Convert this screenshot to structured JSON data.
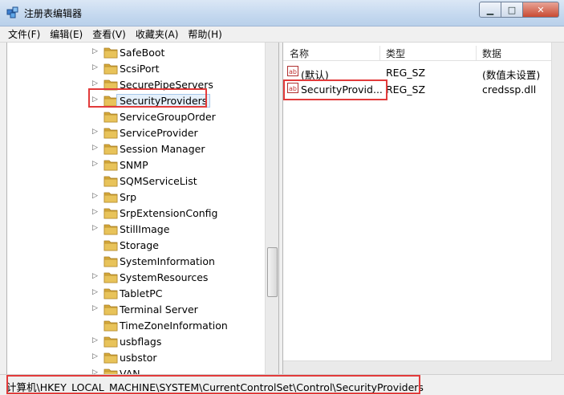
{
  "window": {
    "title": "注册表编辑器",
    "minimize": "▁",
    "maximize": "□",
    "close": "✕"
  },
  "menu": [
    "文件(F)",
    "编辑(E)",
    "查看(V)",
    "收藏夹(A)",
    "帮助(H)"
  ],
  "tree": {
    "items": [
      {
        "label": "SafeBoot",
        "expandable": true
      },
      {
        "label": "ScsiPort",
        "expandable": true
      },
      {
        "label": "SecurePipeServers",
        "expandable": true
      },
      {
        "label": "SecurityProviders",
        "expandable": true,
        "selected": true
      },
      {
        "label": "ServiceGroupOrder",
        "expandable": false
      },
      {
        "label": "ServiceProvider",
        "expandable": true
      },
      {
        "label": "Session Manager",
        "expandable": true
      },
      {
        "label": "SNMP",
        "expandable": true
      },
      {
        "label": "SQMServiceList",
        "expandable": false
      },
      {
        "label": "Srp",
        "expandable": true
      },
      {
        "label": "SrpExtensionConfig",
        "expandable": true
      },
      {
        "label": "StillImage",
        "expandable": true
      },
      {
        "label": "Storage",
        "expandable": false
      },
      {
        "label": "SystemInformation",
        "expandable": false
      },
      {
        "label": "SystemResources",
        "expandable": true
      },
      {
        "label": "TabletPC",
        "expandable": true
      },
      {
        "label": "Terminal Server",
        "expandable": true
      },
      {
        "label": "TimeZoneInformation",
        "expandable": false
      },
      {
        "label": "usbflags",
        "expandable": true
      },
      {
        "label": "usbstor",
        "expandable": true
      },
      {
        "label": "VAN",
        "expandable": true
      }
    ]
  },
  "list": {
    "columns": [
      "名称",
      "类型",
      "数据"
    ],
    "rows": [
      {
        "name": "(默认)",
        "type": "REG_SZ",
        "data": "(数值未设置)"
      },
      {
        "name": "SecurityProvid...",
        "type": "REG_SZ",
        "data": "credssp.dll"
      }
    ]
  },
  "status": {
    "path": "计算机\\HKEY_LOCAL_MACHINE\\SYSTEM\\CurrentControlSet\\Control\\SecurityProviders"
  },
  "colors": {
    "highlight": "#e23b3b",
    "folder": "#e8c35a",
    "selection": "#e5f0fb"
  }
}
